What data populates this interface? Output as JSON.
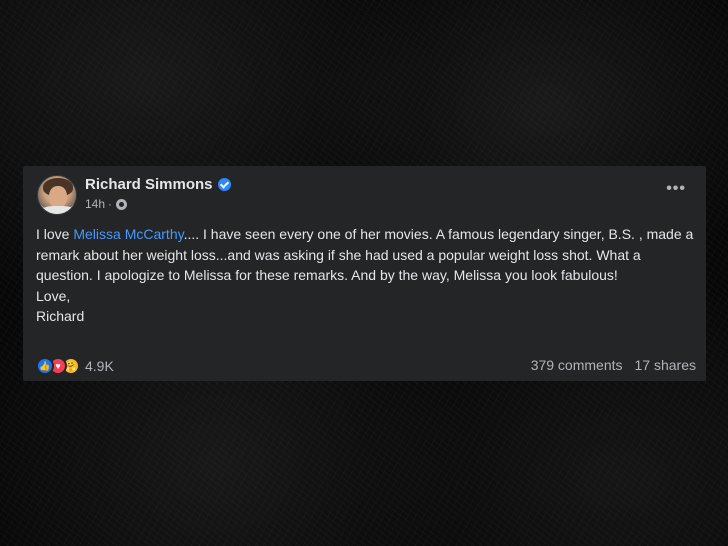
{
  "post": {
    "author": "Richard Simmons",
    "time": "14h",
    "more_label": "•••",
    "body_before_mention": "I love ",
    "mention": "Melissa McCarthy",
    "body_after_mention": ".... I have seen every one of her movies. A famous legendary singer, B.S. , made a remark about her weight loss...and was asking if she had used a popular weight loss shot. What a question. I apologize to Melissa for these remarks. And by the way, Melissa you look fabulous!",
    "closing": "Love,",
    "signature": "Richard",
    "reaction_count": "4.9K",
    "comments": "379 comments",
    "shares": "17 shares",
    "reactions": [
      "like-icon",
      "love-icon",
      "care-icon"
    ]
  },
  "colors": {
    "card_bg": "#242526",
    "text": "#e4e6eb",
    "secondary_text": "#b0b3b8",
    "mention": "#4599ff",
    "verified": "#2d88ff"
  }
}
